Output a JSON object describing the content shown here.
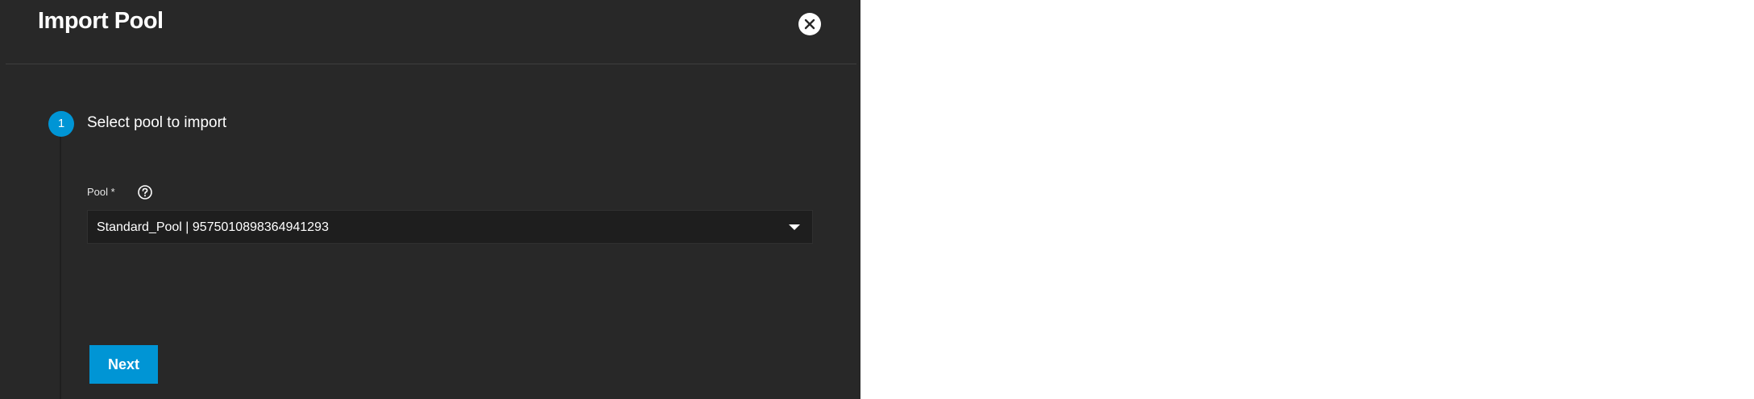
{
  "dialog": {
    "title": "Import Pool",
    "close_icon": "close-icon"
  },
  "stepper": {
    "steps": [
      {
        "number": "1",
        "label": "Select pool to import"
      }
    ]
  },
  "form": {
    "pool_label": "Pool *",
    "help_icon": "help-circle-icon",
    "pool_value": "Standard_Pool | 9575010898364941293",
    "dropdown_icon": "caret-down-icon"
  },
  "actions": {
    "next_label": "Next"
  },
  "colors": {
    "panel_bg": "#282828",
    "accent": "#0095d5",
    "field_bg": "#1e1e1e",
    "page_bg": "#ffffff"
  }
}
